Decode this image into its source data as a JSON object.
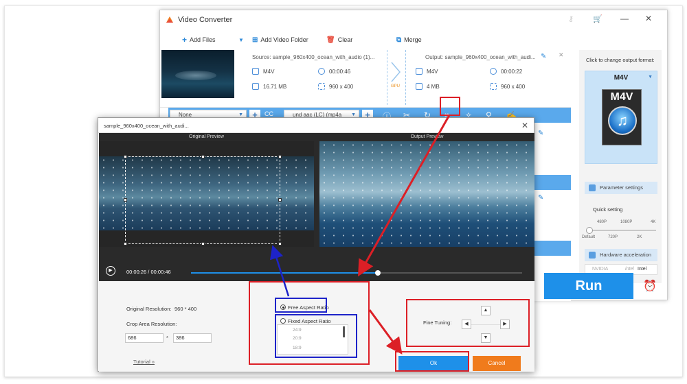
{
  "app": {
    "title": "Video Converter",
    "toolbar": {
      "add_files": "Add Files",
      "add_video_folder": "Add Video Folder",
      "clear": "Clear",
      "merge": "Merge"
    }
  },
  "file": {
    "source_name": "Source: sample_960x400_ocean_with_audio (1)...",
    "output_name": "Output: sample_960x400_ocean_with_audi...",
    "source": {
      "format": "M4V",
      "duration": "00:00:46",
      "size": "16.71 MB",
      "resolution": "960 x 400"
    },
    "output": {
      "format": "M4V",
      "duration": "00:00:22",
      "size": "4 MB",
      "resolution": "960 x 400"
    },
    "gpu_label": "GPU",
    "subtitle_select": "None",
    "audio_select": "und aac (LC) (mp4a"
  },
  "right_panel": {
    "change_format_label": "Click to change output format:",
    "format": "M4V",
    "format_card_text": "M4V",
    "param_settings": "Parameter settings",
    "quick_setting": "Quick setting",
    "quality_top": [
      "480P",
      "1080P",
      "4K"
    ],
    "quality_bottom": [
      "Default",
      "720P",
      "2K"
    ],
    "hw_accel": "Hardware acceleration",
    "hw_vendors": [
      "NVIDIA",
      "Intel"
    ]
  },
  "run_label": "Run",
  "dialog": {
    "title": "sample_960x400_ocean_with_audi...",
    "original_preview": "Original Preview",
    "output_preview": "Output Preview",
    "time_current": "00:00:26",
    "time_sep": "/",
    "time_total": "00:00:46",
    "original_resolution_label": "Original Resolution:",
    "original_resolution_value": "960 * 400",
    "crop_area_label": "Crop Area Resolution:",
    "crop_width": "686",
    "crop_times": "*",
    "crop_height": "386",
    "free_aspect": "Free Aspect Ratio",
    "fixed_aspect": "Fixed Aspect Ratio",
    "ratios": [
      "24:9",
      "20:9",
      "18:9"
    ],
    "fine_tuning": "Fine Tuning:",
    "tutorial": "Tutorial »",
    "ok": "Ok",
    "cancel": "Cancel"
  },
  "colors": {
    "accent_blue": "#1e90e9",
    "bar_blue": "#5aa9ec",
    "cancel_orange": "#f07b1c",
    "annotation_red": "#dc1f26",
    "annotation_blue": "#1d23c9"
  }
}
